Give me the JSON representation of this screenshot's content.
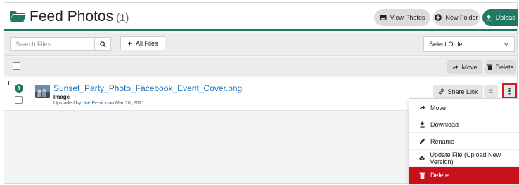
{
  "header": {
    "title": "Feed Photos",
    "count": "(1)",
    "view_photos_label": "View Photos",
    "new_folder_label": "New Folder",
    "upload_label": "Upload"
  },
  "toolbar": {
    "search_placeholder": "Search Files",
    "all_files_label": "All Files",
    "select_order": "Select Order"
  },
  "bulk": {
    "move_label": "Move",
    "delete_label": "Delete"
  },
  "file": {
    "index": "1",
    "name": "Sunset_Party_Photo_Facebook_Event_Cover.png",
    "type": "Image",
    "uploaded_prefix": "Uploaded by",
    "uploaded_user": "Joe Perrick",
    "uploaded_suffix": "on Mar 10, 2021",
    "share_link_label": "Share Link"
  },
  "menu": {
    "items": [
      {
        "label": "Move",
        "icon": "arrow-right-icon"
      },
      {
        "label": "Download",
        "icon": "download-icon"
      },
      {
        "label": "Rename",
        "icon": "pencil-icon"
      },
      {
        "label": "Update File (Upload New Version)",
        "icon": "cloud-upload-icon"
      },
      {
        "label": "Delete",
        "icon": "trash-icon"
      }
    ]
  },
  "colors": {
    "accent": "#1f7a63",
    "link": "#1d6fb8",
    "danger": "#c8101b",
    "highlight_border": "#d21f1f"
  }
}
